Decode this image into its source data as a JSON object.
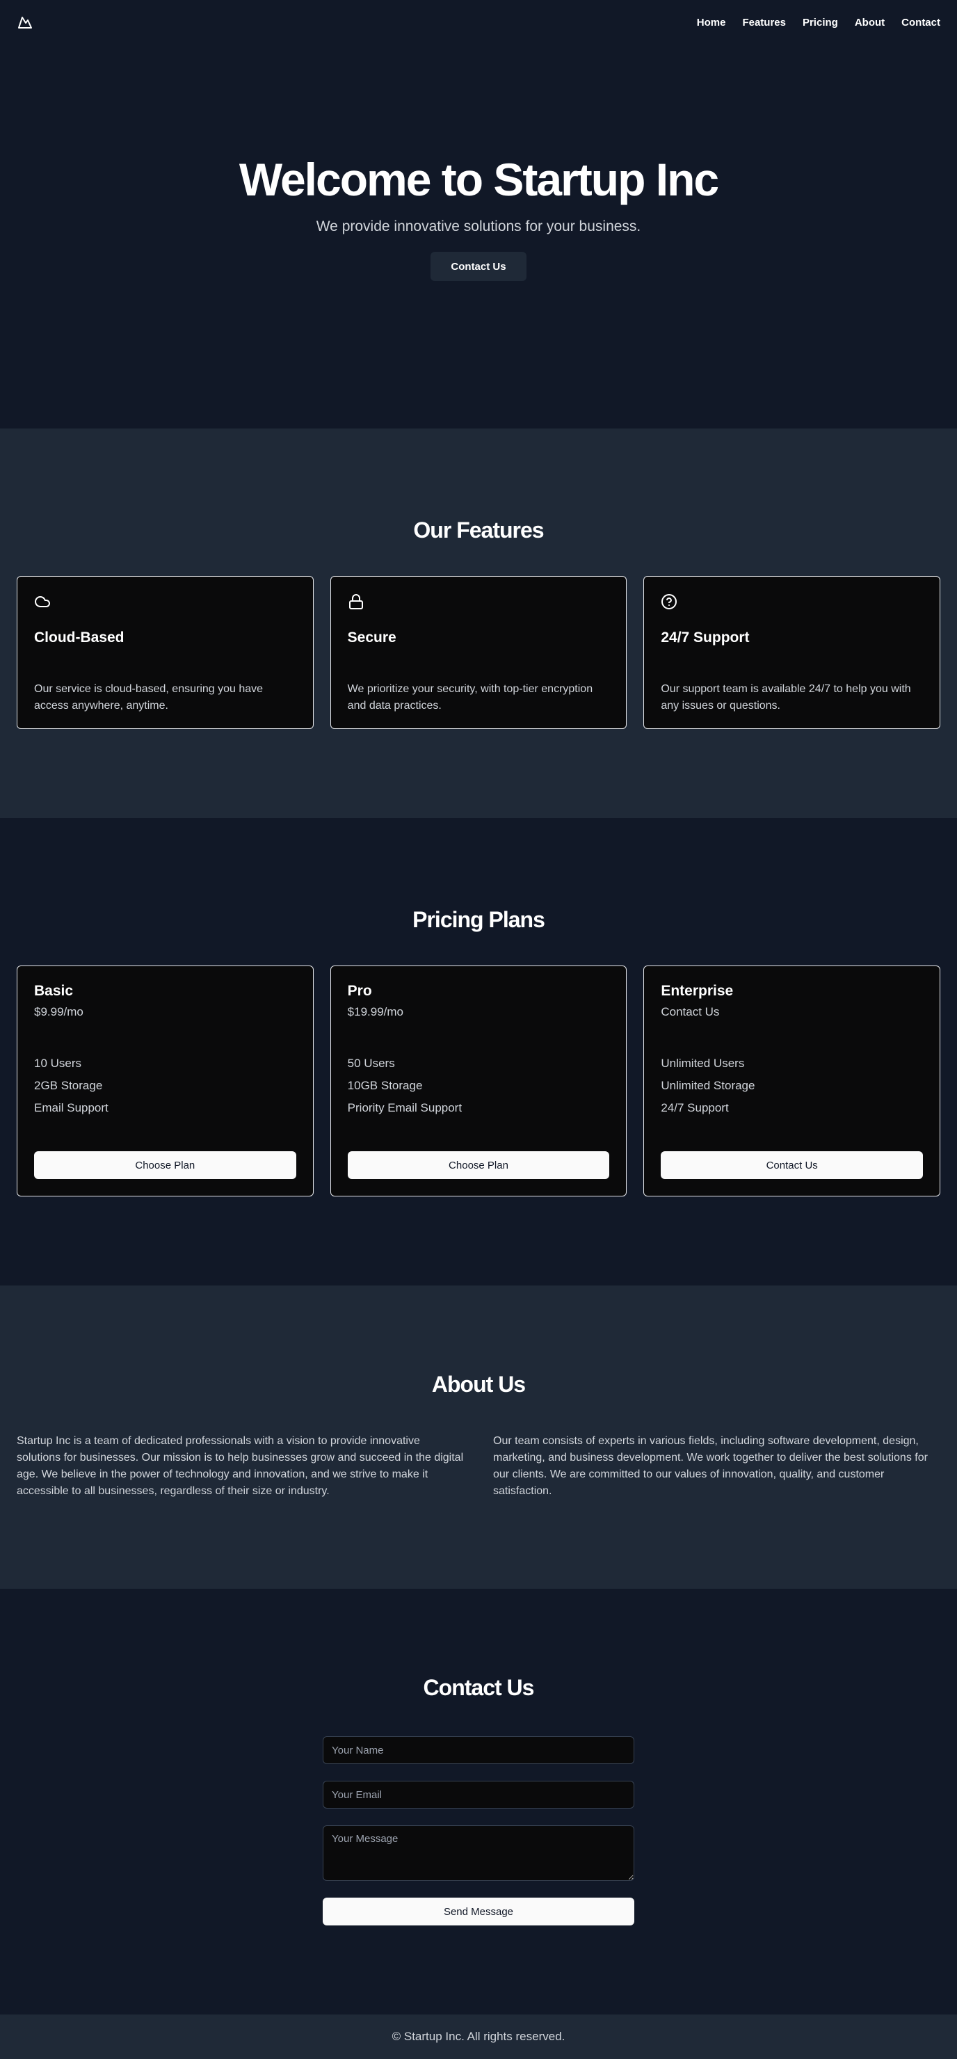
{
  "header": {
    "logo_icon": "mountain-icon",
    "nav": [
      "Home",
      "Features",
      "Pricing",
      "About",
      "Contact"
    ]
  },
  "hero": {
    "title": "Welcome to Startup Inc",
    "subtitle": "We provide innovative solutions for your business.",
    "cta": "Contact Us"
  },
  "features": {
    "title": "Our Features",
    "items": [
      {
        "icon": "cloud-icon",
        "title": "Cloud-Based",
        "desc": "Our service is cloud-based, ensuring you have access anywhere, anytime."
      },
      {
        "icon": "lock-icon",
        "title": "Secure",
        "desc": "We prioritize your security, with top-tier encryption and data practices."
      },
      {
        "icon": "help-circle-icon",
        "title": "24/7 Support",
        "desc": "Our support team is available 24/7 to help you with any issues or questions."
      }
    ]
  },
  "pricing": {
    "title": "Pricing Plans",
    "plans": [
      {
        "name": "Basic",
        "price": "$9.99/mo",
        "features": [
          "10 Users",
          "2GB Storage",
          "Email Support"
        ],
        "button": "Choose Plan"
      },
      {
        "name": "Pro",
        "price": "$19.99/mo",
        "features": [
          "50 Users",
          "10GB Storage",
          "Priority Email Support"
        ],
        "button": "Choose Plan"
      },
      {
        "name": "Enterprise",
        "price": "Contact Us",
        "features": [
          "Unlimited Users",
          "Unlimited Storage",
          "24/7 Support"
        ],
        "button": "Contact Us"
      }
    ]
  },
  "about": {
    "title": "About Us",
    "paragraphs": [
      "Startup Inc is a team of dedicated professionals with a vision to provide innovative solutions for businesses. Our mission is to help businesses grow and succeed in the digital age. We believe in the power of technology and innovation, and we strive to make it accessible to all businesses, regardless of their size or industry.",
      "Our team consists of experts in various fields, including software development, design, marketing, and business development. We work together to deliver the best solutions for our clients. We are committed to our values of innovation, quality, and customer satisfaction."
    ]
  },
  "contact": {
    "title": "Contact Us",
    "name_placeholder": "Your Name",
    "email_placeholder": "Your Email",
    "message_placeholder": "Your Message",
    "submit": "Send Message"
  },
  "footer": {
    "text": "© Startup Inc. All rights reserved."
  },
  "colors": {
    "background": "#111827",
    "section_alt": "#1f2937",
    "card": "#0a0a0b",
    "button_light": "#fafafa"
  }
}
